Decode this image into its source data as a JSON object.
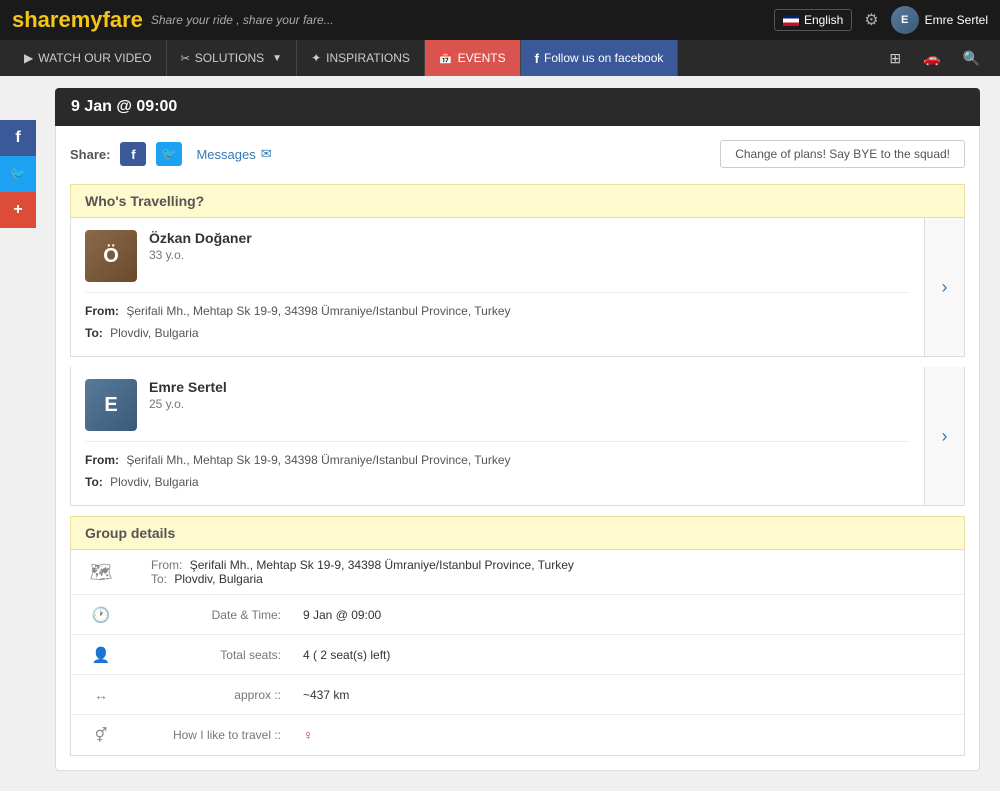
{
  "site": {
    "name_share": "share",
    "name_myfare": "myfare",
    "tagline": "Share your ride , share your fare...",
    "title": "sharemyfare"
  },
  "topbar": {
    "lang_label": "English",
    "user_name": "Emre Sertel",
    "gear_label": "Settings"
  },
  "main_nav": {
    "items": [
      {
        "id": "watch-video",
        "label": "WATCH OUR VIDEO",
        "icon": "play"
      },
      {
        "id": "solutions",
        "label": "SOLUTIONS",
        "icon": "scissors",
        "has_arrow": true
      },
      {
        "id": "inspirations",
        "label": "INSPIRATIONS",
        "icon": "inspiration"
      },
      {
        "id": "events",
        "label": "EVENTS",
        "icon": "calendar",
        "style": "events"
      },
      {
        "id": "facebook-follow",
        "label": "Follow us on facebook",
        "icon": "facebook",
        "style": "facebook"
      }
    ],
    "right_icons": [
      "grid",
      "car",
      "search"
    ]
  },
  "page": {
    "date_header": "9 Jan @ 09:00",
    "share_label": "Share:",
    "messages_label": "Messages",
    "bye_button": "Change of plans! Say BYE to the squad!",
    "who_travelling_header": "Who's Travelling?",
    "group_details_header": "Group details"
  },
  "travelers": [
    {
      "id": "ozkan",
      "name": "Özkan Doğaner",
      "age": "33 y.o.",
      "from": "Şerifali Mh., Mehtap Sk 19-9, 34398 Ümraniye/Istanbul Province, Turkey",
      "to": "Plovdiv, Bulgaria",
      "avatar_initials": "Ö"
    },
    {
      "id": "emre",
      "name": "Emre Sertel",
      "age": "25 y.o.",
      "from": "Şerifali Mh., Mehtap Sk 19-9, 34398 Ümraniye/Istanbul Province, Turkey",
      "to": "Plovdiv, Bulgaria",
      "avatar_initials": "E"
    }
  ],
  "group_details": {
    "from": "Şerifali Mh., Mehtap Sk 19-9, 34398 Ümraniye/Istanbul Province, Turkey",
    "to": "Plovdiv, Bulgaria",
    "date_time_label": "Date & Time:",
    "date_time_value": "9 Jan @ 09:00",
    "total_seats_label": "Total seats:",
    "total_seats_value": "4 ( 2 seat(s) left)",
    "approx_label": "approx ::",
    "approx_value": "~437 km",
    "travel_label": "How I like to travel ::",
    "travel_value": "♀",
    "from_label": "From:",
    "to_label": "To:"
  },
  "side_social": {
    "facebook": "f",
    "twitter": "t",
    "plus": "+"
  }
}
